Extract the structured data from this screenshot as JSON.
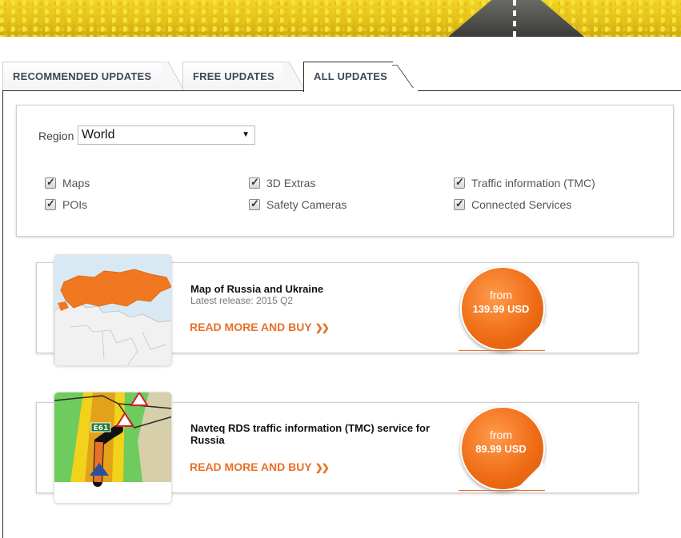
{
  "tabs": [
    {
      "label": "RECOMMENDED UPDATES",
      "active": false
    },
    {
      "label": "FREE UPDATES",
      "active": false
    },
    {
      "label": "ALL UPDATES",
      "active": true
    }
  ],
  "filters": {
    "region_label": "Region",
    "region_value": "World",
    "checkboxes": [
      {
        "label": "Maps",
        "checked": true
      },
      {
        "label": "3D Extras",
        "checked": true
      },
      {
        "label": "Traffic information (TMC)",
        "checked": true
      },
      {
        "label": "POIs",
        "checked": true
      },
      {
        "label": "Safety Cameras",
        "checked": true
      },
      {
        "label": "Connected Services",
        "checked": true
      }
    ]
  },
  "products": [
    {
      "title": "Map of Russia and Ukraine",
      "release": "Latest release: 2015 Q2",
      "buy_label": "READ MORE AND BUY",
      "price_from": "from",
      "price": "139.99 USD"
    },
    {
      "title": "Navteq RDS traffic information (TMC) service for Russia",
      "release": "",
      "buy_label": "READ MORE AND BUY",
      "price_from": "from",
      "price": "89.99 USD",
      "road_sign": "E61"
    }
  ],
  "colors": {
    "accent": "#e8702a",
    "tab_text": "#3b4a5a",
    "map_highlight": "#f07820"
  }
}
